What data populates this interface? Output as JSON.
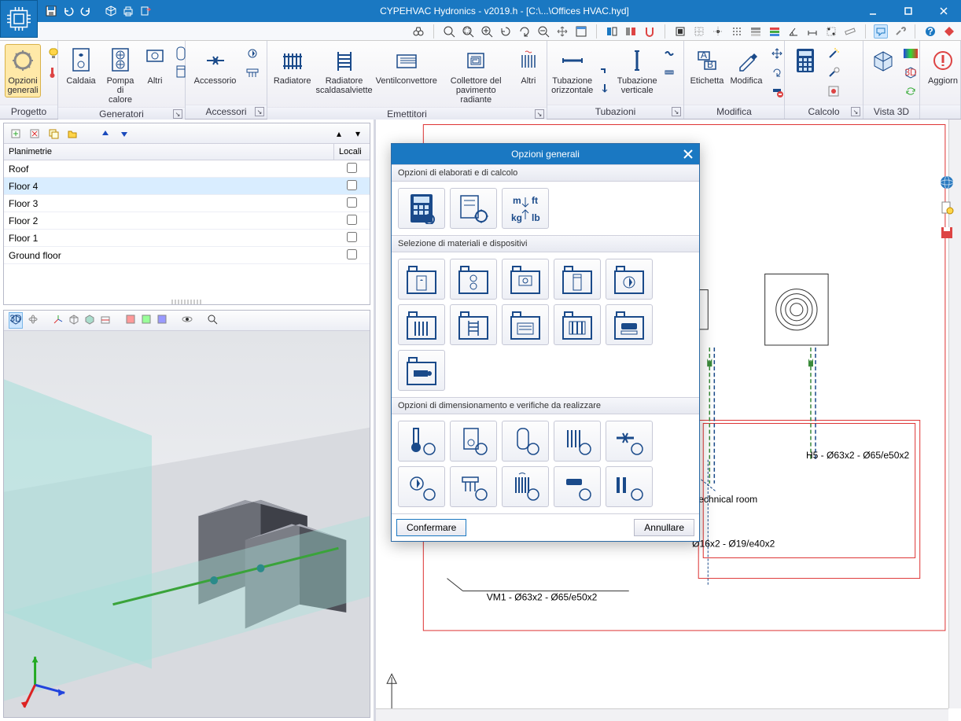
{
  "titlebar": {
    "title": "CYPEHVAC Hydronics - v2019.h - [C:\\...\\Offices HVAC.hyd]"
  },
  "ribbon": {
    "groups": {
      "progetto": {
        "label": "Progetto",
        "opzioni": "Opzioni\ngenerali"
      },
      "generatori": {
        "label": "Generatori",
        "caldaia": "Caldaia",
        "pompa": "Pompa\ndi calore",
        "altri": "Altri"
      },
      "accessori": {
        "label": "Accessori",
        "accessorio": "Accessorio"
      },
      "emettitori": {
        "label": "Emettitori",
        "radiatore": "Radiatore",
        "scalda": "Radiatore\nscaldasalviette",
        "ventil": "Ventilconvettore",
        "collettore": "Collettore del\npavimento radiante",
        "altri": "Altri"
      },
      "tubazioni": {
        "label": "Tubazioni",
        "orizz": "Tubazione\norizzontale",
        "vert": "Tubazione\nverticale"
      },
      "modifica": {
        "label": "Modifica",
        "etichetta": "Etichetta",
        "modifica": "Modifica"
      },
      "calcolo": {
        "label": "Calcolo"
      },
      "vista3d": {
        "label": "Vista 3D"
      },
      "aggiorn": {
        "label": "",
        "aggiorn": "Aggiorn"
      }
    }
  },
  "panel": {
    "header_planimetrie": "Planimetrie",
    "header_locali": "Locali",
    "rows": [
      {
        "name": "Roof",
        "checked": false,
        "sel": false
      },
      {
        "name": "Floor 4",
        "checked": false,
        "sel": true
      },
      {
        "name": "Floor 3",
        "checked": false,
        "sel": false
      },
      {
        "name": "Floor 2",
        "checked": false,
        "sel": false
      },
      {
        "name": "Floor 1",
        "checked": false,
        "sel": false
      },
      {
        "name": "Ground floor",
        "checked": false,
        "sel": false
      }
    ]
  },
  "canvas": {
    "label_pipe1": "H5 - Ø63x2 - Ø65/e50x2",
    "label_room": "Technical room",
    "label_pipe2": "Ø16x2 - Ø19/e40x2",
    "label_pipe3": "VM1 - Ø63x2 - Ø65/e50x2"
  },
  "modal": {
    "title": "Opzioni generali",
    "sec1": "Opzioni di elaborati e di calcolo",
    "sec2": "Selezione di materiali e dispositivi",
    "sec3": "Opzioni di dimensionamento e verifiche da realizzare",
    "confirm": "Confermare",
    "cancel": "Annullare"
  }
}
